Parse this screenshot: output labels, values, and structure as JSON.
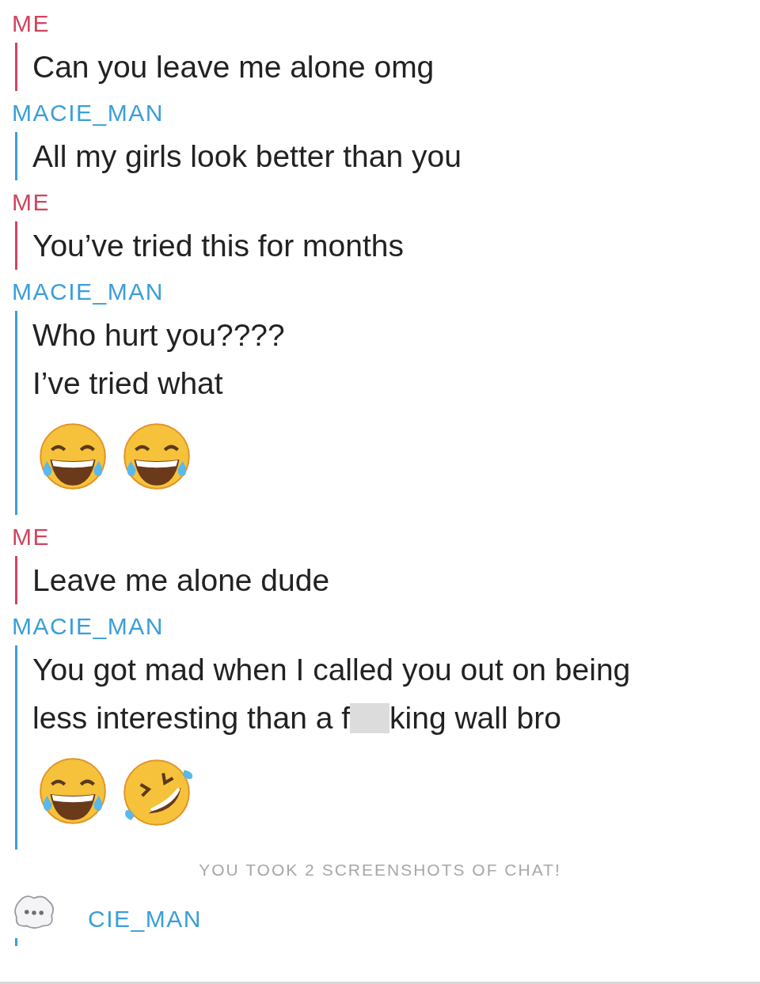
{
  "messages": [
    {
      "sender": "ME",
      "kind": "me",
      "lines": [
        {
          "text": "Can you leave me alone omg"
        }
      ]
    },
    {
      "sender": "MACIE_MAN",
      "kind": "friend",
      "lines": [
        {
          "text": "All my girls look better than you"
        }
      ]
    },
    {
      "sender": "ME",
      "kind": "me",
      "lines": [
        {
          "text": "You’ve tried this for months"
        }
      ]
    },
    {
      "sender": "MACIE_MAN",
      "kind": "friend",
      "lines": [
        {
          "text": "Who hurt you????"
        },
        {
          "text": "I’ve tried what"
        }
      ],
      "emojis": [
        {
          "kind": "tears"
        },
        {
          "kind": "tears"
        }
      ]
    },
    {
      "sender": "ME",
      "kind": "me",
      "lines": [
        {
          "text": "Leave me alone dude"
        }
      ]
    },
    {
      "sender": "MACIE_MAN",
      "kind": "friend",
      "lines": [
        {
          "text": "You got mad when I called you out on being"
        },
        {
          "parts": [
            "less interesting than a f",
            "king wall bro"
          ]
        }
      ],
      "emojis": [
        {
          "kind": "tears"
        },
        {
          "kind": "rolling"
        }
      ]
    }
  ],
  "notice": "YOU TOOK 2 SCREENSHOTS OF CHAT!",
  "typing": {
    "sender": "CIE_MAN",
    "kind": "friend"
  }
}
